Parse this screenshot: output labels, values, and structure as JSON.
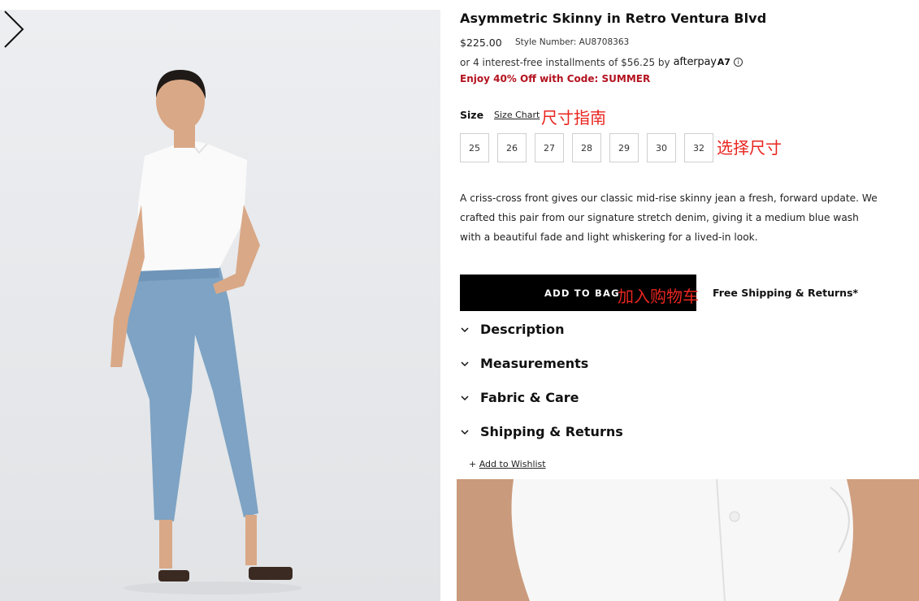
{
  "product": {
    "title": "Asymmetric Skinny in Retro Ventura Blvd",
    "price": "$225.00",
    "style_number": "Style Number: AU8708363",
    "installments_text": "or 4 interest-free installments of $56.25 by",
    "afterpay_logo": "afterpay",
    "afterpay_mark": "A7",
    "info_icon": "i",
    "promo": "Enjoy 40% Off with Code: SUMMER"
  },
  "size": {
    "label": "Size",
    "chart_link": "Size Chart",
    "options": [
      "25",
      "26",
      "27",
      "28",
      "29",
      "30",
      "32"
    ]
  },
  "description": "A criss-cross front gives our classic mid-rise skinny jean a fresh, forward update. We crafted this pair from our signature stretch denim, giving it a medium blue wash with a beautiful fade and light whiskering for a lived-in look.",
  "cta": {
    "add_to_bag": "ADD TO BAG",
    "free_shipping": "Free Shipping & Returns*"
  },
  "accordion": [
    {
      "label": "Description"
    },
    {
      "label": "Measurements"
    },
    {
      "label": "Fabric & Care"
    },
    {
      "label": "Shipping & Returns"
    }
  ],
  "wishlist": {
    "plus": "+",
    "label": "Add to Wishlist"
  },
  "annotations": {
    "size_chart": "尺寸指南",
    "select_size": "选择尺寸",
    "add_to_bag": "加入购物车"
  },
  "colors": {
    "promo_red": "#b3121f",
    "annotation_red": "#e8251f",
    "button_black": "#000000"
  },
  "icons": {
    "next": "chevron-right-icon",
    "accordion": "chevron-down-icon",
    "info": "info-icon"
  }
}
